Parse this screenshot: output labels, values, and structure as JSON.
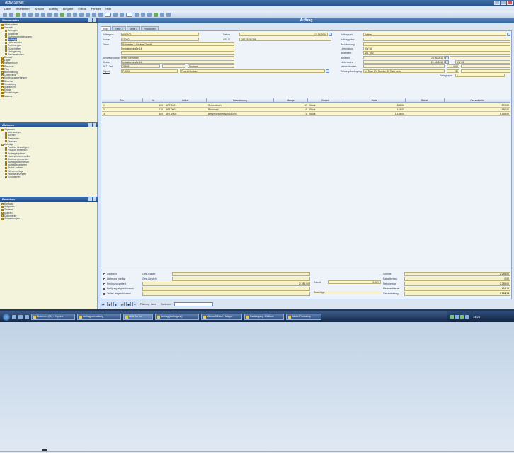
{
  "window": {
    "title": "Aktiv Server"
  },
  "menu": [
    "Datei",
    "Bearbeiten",
    "Ansicht",
    "Auftrag",
    "Eingabe",
    "Extras",
    "Fenster",
    "Hilfe"
  ],
  "document": {
    "title": "Auftrag"
  },
  "panels": {
    "stammdaten": {
      "title": "Stammdaten",
      "items": [
        {
          "label": "Adressdaten",
          "indent": 0
        },
        {
          "label": "Verkauf",
          "indent": 0
        },
        {
          "label": "Anfragen",
          "indent": 1
        },
        {
          "label": "Angebote",
          "indent": 1
        },
        {
          "label": "Auftragsbestätigungen",
          "indent": 1
        },
        {
          "label": "Aufträge",
          "indent": 1,
          "selected": true
        },
        {
          "label": "Lieferscheine",
          "indent": 1
        },
        {
          "label": "Rechnungen",
          "indent": 1
        },
        {
          "label": "Gutschriften",
          "indent": 1
        },
        {
          "label": "Umlagerung",
          "indent": 1
        },
        {
          "label": "Reklamationen",
          "indent": 1
        },
        {
          "label": "Einkauf",
          "indent": 0
        },
        {
          "label": "Lager",
          "indent": 0
        },
        {
          "label": "Kassenbuch",
          "indent": 0
        },
        {
          "label": "Personal",
          "indent": 0
        },
        {
          "label": "Fibu",
          "indent": 0
        },
        {
          "label": "Buchhaltung",
          "indent": 0
        },
        {
          "label": "Controlling",
          "indent": 0
        },
        {
          "label": "Kontenauswertungen",
          "indent": 0
        },
        {
          "label": "Berichte",
          "indent": 0
        },
        {
          "label": "Verwaltung",
          "indent": 0
        },
        {
          "label": "Statistiken",
          "indent": 0
        },
        {
          "label": "Extras",
          "indent": 0
        },
        {
          "label": "Einstellungen",
          "indent": 0
        },
        {
          "label": "Makros",
          "indent": 0
        }
      ]
    },
    "aktionen": {
      "title": "Aktionen",
      "items": [
        {
          "label": "Allgemein",
          "indent": 0
        },
        {
          "label": "Neu anlegen",
          "indent": 1
        },
        {
          "label": "Suchen",
          "indent": 1
        },
        {
          "label": "Bearbeiten",
          "indent": 1
        },
        {
          "label": "Drucken",
          "indent": 1
        },
        {
          "label": "Aufträge",
          "indent": 0
        },
        {
          "label": "Position hinzufügen",
          "indent": 1
        },
        {
          "label": "Position entfernen",
          "indent": 1
        },
        {
          "label": "Auftrag kopieren",
          "indent": 1
        },
        {
          "label": "Lieferschein erstellen",
          "indent": 1
        },
        {
          "label": "Rechnung erstellen",
          "indent": 1
        },
        {
          "label": "Auftrag abschließen",
          "indent": 1
        },
        {
          "label": "Auftrag stornieren",
          "indent": 1
        },
        {
          "label": "Status ändern",
          "indent": 1
        },
        {
          "label": "Wiedervorlage",
          "indent": 1
        },
        {
          "label": "Historie anzeigen",
          "indent": 1
        },
        {
          "label": "Exportieren",
          "indent": 1
        }
      ]
    },
    "favoriten": {
      "title": "Favoriten",
      "items": [
        {
          "label": "Kontakte",
          "indent": 0
        },
        {
          "label": "Aufgaben",
          "indent": 0
        },
        {
          "label": "Termine",
          "indent": 0
        },
        {
          "label": "Notizen",
          "indent": 0
        },
        {
          "label": "Dokumente",
          "indent": 0
        },
        {
          "label": "Auswertungen",
          "indent": 0
        }
      ]
    }
  },
  "tabs": [
    "Kopf",
    "Seite 2",
    "Seite 3",
    "Positionen"
  ],
  "form": {
    "left": [
      {
        "label": "Auftragsnr.",
        "value": "AU0100"
      },
      {
        "label": "Kunde",
        "value": "10040"
      },
      {
        "label": "Firma",
        "value": "Schneider & Partner GmbH"
      },
      {
        "label": "",
        "value": "Industriestraße 14"
      },
      {
        "label": "",
        "value": ""
      },
      {
        "label": "Ansprechpartner",
        "value": "Herr Schneider"
      },
      {
        "label": "Straße",
        "value": "Industriestraße 14"
      },
      {
        "label": "PLZ / Ort",
        "value": "70565",
        "extra": "Stuttgart"
      },
      {
        "label": "Objekt",
        "value": "P-0001",
        "extra": "Projekt Umbau"
      }
    ],
    "mid": [
      {
        "label": "Datum",
        "value": "12.06.2010"
      },
      {
        "label": "USt-ID",
        "value": "DE123456789"
      }
    ],
    "right": [
      {
        "label": "Auftragsart",
        "value": "Auftrag"
      },
      {
        "label": "Auftraggeber",
        "value": ""
      },
      {
        "label": "Bezeichnung",
        "value": ""
      },
      {
        "label": "Lieferdatum",
        "value": "KW 26"
      },
      {
        "label": "Bearbeiter",
        "value": "MA_002"
      },
      {
        "label": "Bestellnr.",
        "value": "",
        "date": "18.06.2010"
      },
      {
        "label": "Lieferwoche",
        "value": "",
        "date": "21.06.2010",
        "extra": "KW 25"
      },
      {
        "label": "Versandkosten",
        "value": "",
        "pct": "0,00"
      },
      {
        "label": "Zahlungsbedingung",
        "value": "14 Tage 2% Skonto, 30 Tage netto",
        "pct": "30"
      },
      {
        "label": "Preisgruppe",
        "value": "1"
      }
    ]
  },
  "grid": {
    "columns": [
      "Pos.",
      "Nr.",
      "Artikel",
      "Bezeichnung",
      "Menge",
      "Einheit",
      "Preis",
      "Rabatt",
      "Gesamtpreis"
    ],
    "rows": [
      [
        "1",
        "100",
        "ART-0001",
        "Schreibtisch",
        "2",
        "Stück",
        "285,00",
        "",
        "570,00"
      ],
      [
        "2",
        "210",
        "ART-0002",
        "Bürostuhl",
        "4",
        "Stück",
        "145,00",
        "",
        "580,00"
      ],
      [
        "3",
        "300",
        "ART-1000",
        "Besprechungstisch 180x90",
        "1",
        "Stück",
        "1.135,00",
        "",
        "1.135,00"
      ]
    ]
  },
  "totals": {
    "checks": [
      "Gedruckt",
      "Lieferung erledigt",
      "Rechnung gestellt",
      "Fertigung abgeschlossen",
      "Teillief. abgeschlossen"
    ],
    "mid": [
      {
        "label": "Ges.-Rabatt",
        "value": ""
      },
      {
        "label": "Ges.-Gewicht",
        "value": ""
      },
      {
        "label": "Brutto",
        "value": "2.285,00"
      },
      {
        "label": "",
        "value": ""
      },
      {
        "label": "",
        "value": ""
      }
    ],
    "rabatt_label": "Rabatt",
    "rabatt_value": "0,00%",
    "zuschlag_label": "Zuschläge",
    "right": [
      {
        "label": "Summe",
        "value": "2.285,00"
      },
      {
        "label": "Rabattbetrag",
        "value": "0,00"
      },
      {
        "label": "Nettobetrag",
        "value": "2.285,00"
      },
      {
        "label": "Mehrwertsteuer",
        "value": "434,15"
      },
      {
        "label": "Gesamtbetrag",
        "value": "2.719,15"
      }
    ]
  },
  "nav": {
    "filter_label": "Filterung: keine",
    "sort_label": "Sortieren:",
    "sort_value": ""
  },
  "taskbar": {
    "tasks": [
      "Dokument (D:) - Explorer",
      "Auftragsverwaltung",
      "Aktiv Server",
      "Auftrag (Auftragsnr.)",
      "Microsoft Excel - Mappe",
      "Posteingang - Outlook",
      "Adobe Photoshop"
    ],
    "clock": "14:26"
  }
}
